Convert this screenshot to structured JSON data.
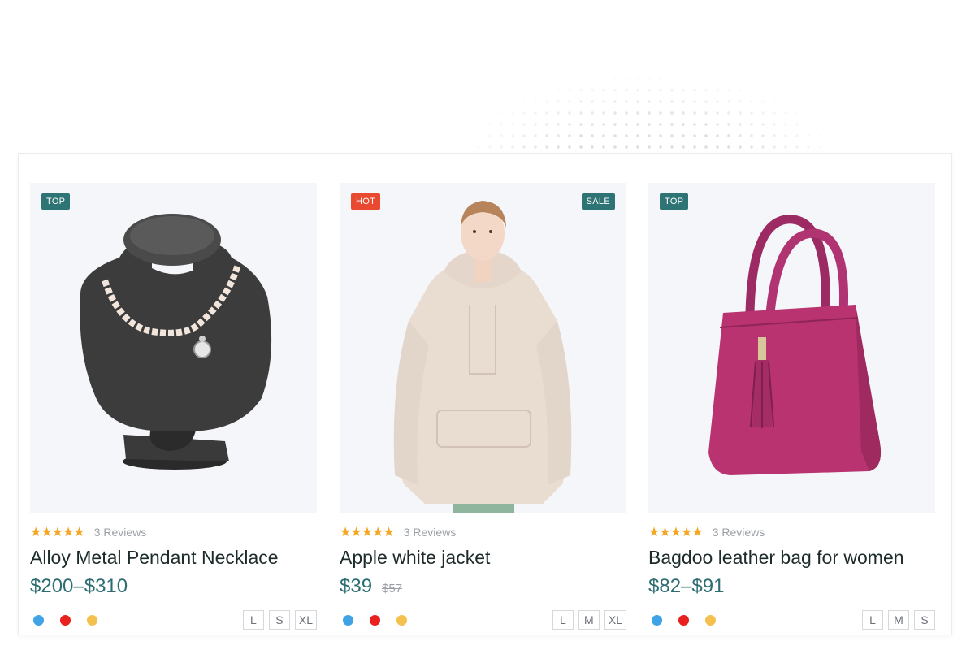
{
  "colors": {
    "teal": "#2f7475",
    "hot": "#e8492f",
    "price": "#2d6d72",
    "star": "#f5a623",
    "swatch_blue": "#3fa3e6",
    "swatch_red": "#e8201e",
    "swatch_yellow": "#f4c04e"
  },
  "products": [
    {
      "badges": {
        "left": "TOP",
        "left_color": "#2f7475",
        "right": ""
      },
      "image": "necklace-on-black-bust",
      "stars": "★★★★★",
      "reviews": "3 Reviews",
      "title": "Alloy Metal Pendant Necklace",
      "price": "$200–$310",
      "old_price": "",
      "swatches": [
        "#3fa3e6",
        "#e8201e",
        "#f4c04e"
      ],
      "sizes": [
        "L",
        "S",
        "XL"
      ]
    },
    {
      "badges": {
        "left": "HOT",
        "left_color": "#e8492f",
        "right": "SALE",
        "right_color": "#2f7475"
      },
      "image": "woman-in-beige-hoodie",
      "stars": "★★★★★",
      "reviews": "3 Reviews",
      "title": "Apple white jacket",
      "price": "$39",
      "old_price": "$57",
      "swatches": [
        "#3fa3e6",
        "#e8201e",
        "#f4c04e"
      ],
      "sizes": [
        "L",
        "M",
        "XL"
      ]
    },
    {
      "badges": {
        "left": "TOP",
        "left_color": "#2f7475",
        "right": ""
      },
      "image": "magenta-leather-handbag",
      "stars": "★★★★★",
      "reviews": "3 Reviews",
      "title": "Bagdoo leather bag for women",
      "price": "$82–$91",
      "old_price": "",
      "swatches": [
        "#3fa3e6",
        "#e8201e",
        "#f4c04e"
      ],
      "sizes": [
        "L",
        "M",
        "S"
      ]
    }
  ]
}
